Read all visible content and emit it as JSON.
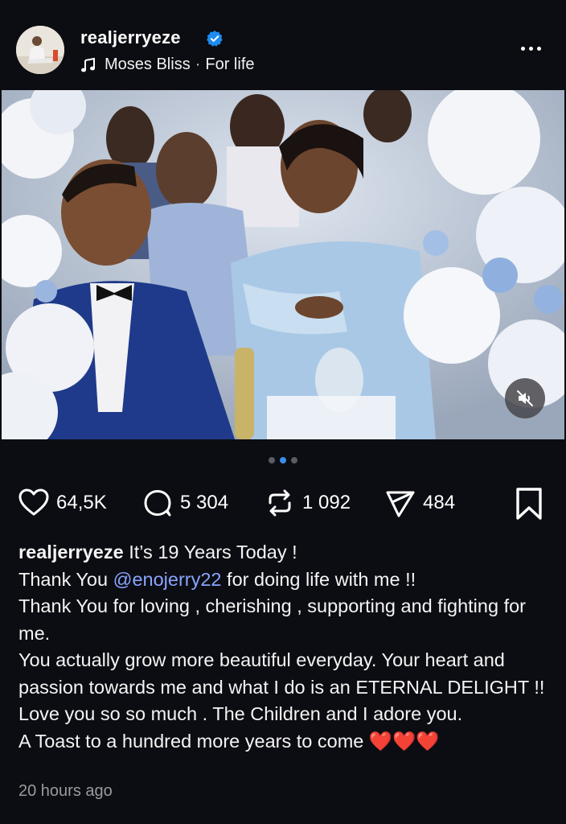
{
  "post": {
    "username": "realjerryeze",
    "verified": true,
    "audio": {
      "artist": "Moses Bliss",
      "separator": "·",
      "track": "For life"
    },
    "media": {
      "carousel_count": 3,
      "active_index": 1,
      "muted": true
    },
    "stats": {
      "likes": "64,5K",
      "comments": "5 304",
      "reposts": "1 092",
      "shares": "484"
    },
    "caption": {
      "username": "realjerryeze",
      "line1": "It’s 19 Years Today !",
      "line2_prefix": "Thank You ",
      "mention": "@enojerry22",
      "line2_suffix": " for doing life with me !!",
      "line3": "Thank You for loving , cherishing , supporting and fighting for me.",
      "line4": "You actually grow more beautiful everyday. Your heart and passion towards me and what I do is an ETERNAL DELIGHT !!",
      "line5": "Love you so so much . The Children and I adore you.",
      "line6": "A Toast to a hundred more years to come",
      "hearts": "❤️❤️❤️"
    },
    "timestamp": "20 hours ago"
  },
  "colors": {
    "background": "#0c0d12",
    "verified": "#1d8cf0",
    "mention": "#8aa4ff",
    "active_dot": "#3b8eea",
    "heart": "#e0202c"
  },
  "icons": {
    "like": "heart-outline-icon",
    "comment": "speech-bubble-icon",
    "repost": "repeat-icon",
    "share": "paper-plane-icon",
    "save": "bookmark-icon",
    "more": "ellipsis-icon",
    "audio": "music-note-icon",
    "mute": "speaker-muted-icon"
  }
}
